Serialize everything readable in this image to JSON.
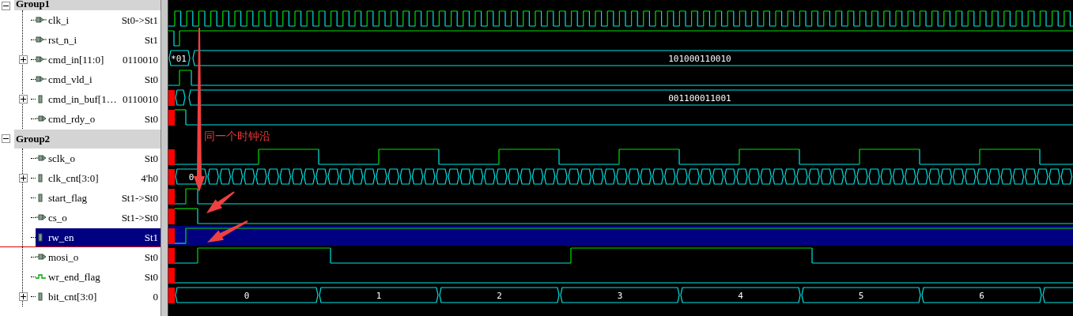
{
  "groups": [
    {
      "name": "Group1",
      "expanded": true,
      "signals": [
        {
          "name": "clk_i",
          "value": "St0->St1",
          "kind": "in",
          "selected": false,
          "uninitialized": false
        },
        {
          "name": "rst_n_i",
          "value": "St1",
          "kind": "in",
          "selected": false,
          "uninitialized": false
        },
        {
          "name": "cmd_in[11:0]",
          "value": "0110010",
          "kind": "in",
          "expanded": false,
          "selected": false,
          "uninitialized": false,
          "segments": [
            "*01",
            "101000110010"
          ]
        },
        {
          "name": "cmd_vld_i",
          "value": "St0",
          "kind": "in",
          "selected": false,
          "uninitialized": false
        },
        {
          "name": "cmd_in_buf[1…",
          "value": "0110010",
          "kind": "reg",
          "expanded": false,
          "selected": false,
          "uninitialized": true,
          "segments": [
            "001100011001"
          ]
        },
        {
          "name": "cmd_rdy_o",
          "value": "St0",
          "kind": "out",
          "selected": false,
          "uninitialized": true
        }
      ]
    },
    {
      "name": "Group2",
      "expanded": true,
      "signals": [
        {
          "name": "sclk_o",
          "value": "St0",
          "kind": "out",
          "selected": false,
          "uninitialized": true
        },
        {
          "name": "clk_cnt[3:0]",
          "value": "4'h0",
          "kind": "reg",
          "expanded": false,
          "selected": false,
          "uninitialized": true,
          "segments": [
            "0"
          ]
        },
        {
          "name": "start_flag",
          "value": "St1->St0",
          "kind": "reg",
          "selected": false,
          "uninitialized": true
        },
        {
          "name": "cs_o",
          "value": "St1->St0",
          "kind": "out",
          "selected": false,
          "uninitialized": true
        },
        {
          "name": "rw_en",
          "value": "St1",
          "kind": "reg",
          "selected": true,
          "uninitialized": true
        },
        {
          "name": "mosi_o",
          "value": "St0",
          "kind": "out",
          "selected": false,
          "uninitialized": true
        },
        {
          "name": "wr_end_flag",
          "value": "St0",
          "kind": "net",
          "selected": false,
          "uninitialized": true
        },
        {
          "name": "bit_cnt[3:0]",
          "value": "0",
          "kind": "reg",
          "expanded": false,
          "selected": false,
          "uninitialized": true,
          "segments": [
            "0",
            "1",
            "2",
            "3",
            "4",
            "5",
            "6"
          ]
        }
      ]
    }
  ],
  "annotation": {
    "text": "同一个时钟沿"
  }
}
